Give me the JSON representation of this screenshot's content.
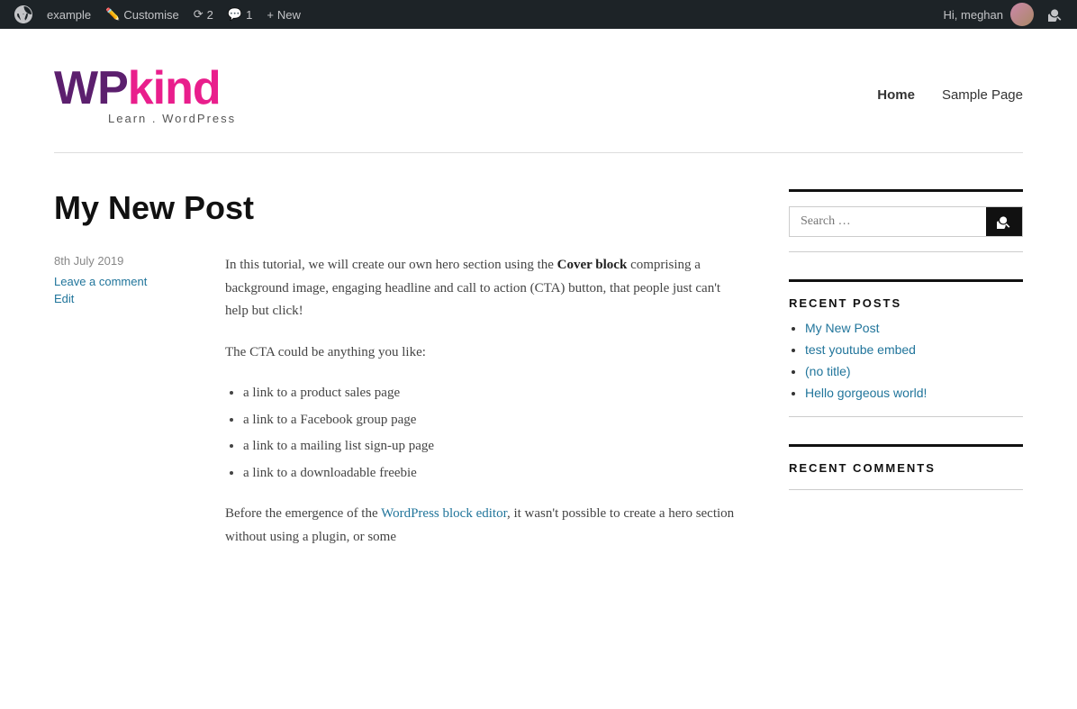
{
  "adminbar": {
    "wp_icon": "wordpress",
    "site_name": "example",
    "customise_label": "Customise",
    "updates_count": "2",
    "comments_count": "1",
    "new_label": "New",
    "hi_text": "Hi, meghan",
    "search_title": "Search"
  },
  "header": {
    "logo_wp": "WP",
    "logo_kind": "kind",
    "tagline": "Learn . WordPress",
    "nav": {
      "home_label": "Home",
      "sample_page_label": "Sample Page"
    }
  },
  "post": {
    "title": "My New Post",
    "date": "8th July 2019",
    "leave_comment": "Leave a comment",
    "edit": "Edit",
    "body_p1_pre": "In this tutorial, we will create our own hero section using the ",
    "body_p1_bold1": "Cover block",
    "body_p1_post": " comprising a background image, engaging headline and call to action (CTA) button, that people just can't help but click!",
    "body_p2": "The CTA could be anything you like:",
    "bullet_items": [
      "a link to a product sales page",
      "a link to a Facebook group page",
      "a link to a mailing list sign-up page",
      "a link to a downloadable freebie"
    ],
    "body_p3_pre": "Before the emergence of the ",
    "body_p3_link": "WordPress block editor",
    "body_p3_post": ", it wasn't possible to create a hero section without using a plugin, or some"
  },
  "sidebar": {
    "search_placeholder": "Search …",
    "search_button_label": "Search",
    "recent_posts_heading": "RECENT POSTS",
    "recent_posts": [
      {
        "label": "My New Post",
        "url": "#"
      },
      {
        "label": "test youtube embed",
        "url": "#"
      },
      {
        "label": "(no title)",
        "url": "#"
      },
      {
        "label": "Hello gorgeous world!",
        "url": "#"
      }
    ],
    "recent_comments_heading": "RECENT COMMENTS"
  }
}
